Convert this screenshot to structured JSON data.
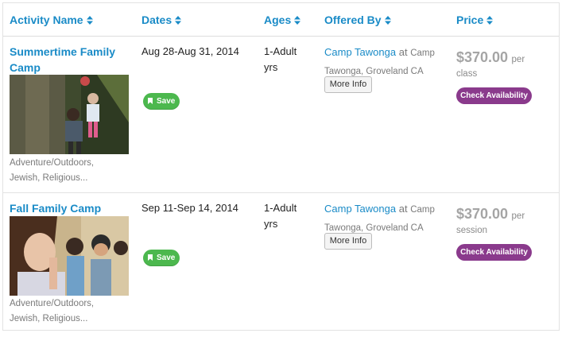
{
  "header": {
    "activity_name": "Activity Name",
    "dates": "Dates",
    "ages": "Ages",
    "offered_by": "Offered By",
    "price": "Price"
  },
  "rows": [
    {
      "title_line1": "Summertime Family",
      "title_line2": "Camp",
      "image": "family-hiking-photo",
      "tags_line1": "Adventure/Outdoors,",
      "tags_line2": "Jewish, Religious...",
      "dates": "Aug 28-Aug 31, 2014",
      "ages_line1": "1-Adult",
      "ages_line2": "yrs",
      "save_label": "Save",
      "camp_name": "Camp Tawonga",
      "at": "at",
      "loc_line1": "Camp",
      "loc_line2": "Tawonga, Groveland CA",
      "more_info": "More Info",
      "price": "$370.00",
      "per": "per",
      "unit": "class",
      "availability": "Check Availability"
    },
    {
      "title_line1": "Fall Family Camp",
      "title_line2": "",
      "image": "children-praying-photo",
      "tags_line1": "Adventure/Outdoors,",
      "tags_line2": "Jewish, Religious...",
      "dates": "Sep 11-Sep 14, 2014",
      "ages_line1": "1-Adult",
      "ages_line2": "yrs",
      "save_label": "Save",
      "camp_name": "Camp Tawonga",
      "at": "at",
      "loc_line1": "Camp",
      "loc_line2": "Tawonga, Groveland CA",
      "more_info": "More Info",
      "price": "$370.00",
      "per": "per",
      "unit": "session",
      "availability": "Check Availability"
    }
  ],
  "colors": {
    "link": "#1a8bc7",
    "save": "#4cb84e",
    "availability": "#8a3a8c",
    "price": "#a5a5a5"
  },
  "icons": [
    "sort-icon",
    "bookmark-icon"
  ]
}
